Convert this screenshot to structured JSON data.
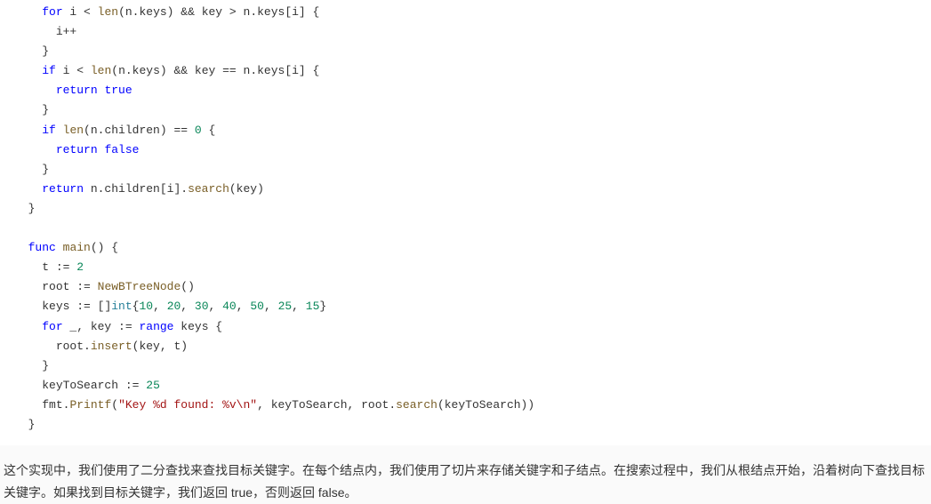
{
  "code": {
    "lines": [
      {
        "indent": 2,
        "tokens": [
          {
            "t": "keyword",
            "v": "for"
          },
          {
            "t": "normal",
            "v": " i "
          },
          {
            "t": "operator",
            "v": "<"
          },
          {
            "t": "normal",
            "v": " "
          },
          {
            "t": "func-name",
            "v": "len"
          },
          {
            "t": "normal",
            "v": "(n.keys) "
          },
          {
            "t": "operator",
            "v": "&&"
          },
          {
            "t": "normal",
            "v": " key "
          },
          {
            "t": "operator",
            "v": ">"
          },
          {
            "t": "normal",
            "v": " n.keys[i] {"
          }
        ]
      },
      {
        "indent": 3,
        "tokens": [
          {
            "t": "normal",
            "v": "i"
          },
          {
            "t": "operator",
            "v": "++"
          }
        ]
      },
      {
        "indent": 2,
        "tokens": [
          {
            "t": "normal",
            "v": "}"
          }
        ]
      },
      {
        "indent": 2,
        "tokens": [
          {
            "t": "keyword",
            "v": "if"
          },
          {
            "t": "normal",
            "v": " i "
          },
          {
            "t": "operator",
            "v": "<"
          },
          {
            "t": "normal",
            "v": " "
          },
          {
            "t": "func-name",
            "v": "len"
          },
          {
            "t": "normal",
            "v": "(n.keys) "
          },
          {
            "t": "operator",
            "v": "&&"
          },
          {
            "t": "normal",
            "v": " key "
          },
          {
            "t": "operator",
            "v": "=="
          },
          {
            "t": "normal",
            "v": " n.keys[i] {"
          }
        ]
      },
      {
        "indent": 3,
        "tokens": [
          {
            "t": "keyword",
            "v": "return"
          },
          {
            "t": "normal",
            "v": " "
          },
          {
            "t": "keyword",
            "v": "true"
          }
        ]
      },
      {
        "indent": 2,
        "tokens": [
          {
            "t": "normal",
            "v": "}"
          }
        ]
      },
      {
        "indent": 2,
        "tokens": [
          {
            "t": "keyword",
            "v": "if"
          },
          {
            "t": "normal",
            "v": " "
          },
          {
            "t": "func-name",
            "v": "len"
          },
          {
            "t": "normal",
            "v": "(n.children) "
          },
          {
            "t": "operator",
            "v": "=="
          },
          {
            "t": "normal",
            "v": " "
          },
          {
            "t": "number",
            "v": "0"
          },
          {
            "t": "normal",
            "v": " {"
          }
        ]
      },
      {
        "indent": 3,
        "tokens": [
          {
            "t": "keyword",
            "v": "return"
          },
          {
            "t": "normal",
            "v": " "
          },
          {
            "t": "keyword",
            "v": "false"
          }
        ]
      },
      {
        "indent": 2,
        "tokens": [
          {
            "t": "normal",
            "v": "}"
          }
        ]
      },
      {
        "indent": 2,
        "tokens": [
          {
            "t": "keyword",
            "v": "return"
          },
          {
            "t": "normal",
            "v": " n.children[i]."
          },
          {
            "t": "func-name",
            "v": "search"
          },
          {
            "t": "normal",
            "v": "(key)"
          }
        ]
      },
      {
        "indent": 1,
        "tokens": [
          {
            "t": "normal",
            "v": "}"
          }
        ]
      },
      {
        "indent": 0,
        "tokens": []
      },
      {
        "indent": 1,
        "tokens": [
          {
            "t": "keyword",
            "v": "func"
          },
          {
            "t": "normal",
            "v": " "
          },
          {
            "t": "func-name",
            "v": "main"
          },
          {
            "t": "normal",
            "v": "() {"
          }
        ]
      },
      {
        "indent": 2,
        "tokens": [
          {
            "t": "normal",
            "v": "t "
          },
          {
            "t": "operator",
            "v": ":="
          },
          {
            "t": "normal",
            "v": " "
          },
          {
            "t": "number",
            "v": "2"
          }
        ]
      },
      {
        "indent": 2,
        "tokens": [
          {
            "t": "normal",
            "v": "root "
          },
          {
            "t": "operator",
            "v": ":="
          },
          {
            "t": "normal",
            "v": " "
          },
          {
            "t": "func-name",
            "v": "NewBTreeNode"
          },
          {
            "t": "normal",
            "v": "()"
          }
        ]
      },
      {
        "indent": 2,
        "tokens": [
          {
            "t": "normal",
            "v": "keys "
          },
          {
            "t": "operator",
            "v": ":="
          },
          {
            "t": "normal",
            "v": " []"
          },
          {
            "t": "type",
            "v": "int"
          },
          {
            "t": "normal",
            "v": "{"
          },
          {
            "t": "number",
            "v": "10"
          },
          {
            "t": "normal",
            "v": ", "
          },
          {
            "t": "number",
            "v": "20"
          },
          {
            "t": "normal",
            "v": ", "
          },
          {
            "t": "number",
            "v": "30"
          },
          {
            "t": "normal",
            "v": ", "
          },
          {
            "t": "number",
            "v": "40"
          },
          {
            "t": "normal",
            "v": ", "
          },
          {
            "t": "number",
            "v": "50"
          },
          {
            "t": "normal",
            "v": ", "
          },
          {
            "t": "number",
            "v": "25"
          },
          {
            "t": "normal",
            "v": ", "
          },
          {
            "t": "number",
            "v": "15"
          },
          {
            "t": "normal",
            "v": "}"
          }
        ]
      },
      {
        "indent": 2,
        "tokens": [
          {
            "t": "keyword",
            "v": "for"
          },
          {
            "t": "normal",
            "v": " _, key "
          },
          {
            "t": "operator",
            "v": ":="
          },
          {
            "t": "normal",
            "v": " "
          },
          {
            "t": "keyword",
            "v": "range"
          },
          {
            "t": "normal",
            "v": " keys {"
          }
        ]
      },
      {
        "indent": 3,
        "tokens": [
          {
            "t": "normal",
            "v": "root."
          },
          {
            "t": "func-name",
            "v": "insert"
          },
          {
            "t": "normal",
            "v": "(key, t)"
          }
        ]
      },
      {
        "indent": 2,
        "tokens": [
          {
            "t": "normal",
            "v": "}"
          }
        ]
      },
      {
        "indent": 2,
        "tokens": [
          {
            "t": "normal",
            "v": "keyToSearch "
          },
          {
            "t": "operator",
            "v": ":="
          },
          {
            "t": "normal",
            "v": " "
          },
          {
            "t": "number",
            "v": "25"
          }
        ]
      },
      {
        "indent": 2,
        "tokens": [
          {
            "t": "normal",
            "v": "fmt."
          },
          {
            "t": "func-name",
            "v": "Printf"
          },
          {
            "t": "normal",
            "v": "("
          },
          {
            "t": "string",
            "v": "\"Key %d found: %v\\n\""
          },
          {
            "t": "normal",
            "v": ", keyToSearch, root."
          },
          {
            "t": "func-name",
            "v": "search"
          },
          {
            "t": "normal",
            "v": "(keyToSearch))"
          }
        ]
      },
      {
        "indent": 1,
        "tokens": [
          {
            "t": "normal",
            "v": "}"
          }
        ]
      }
    ]
  },
  "paragraph": "这个实现中，我们使用了二分查找来查找目标关键字。在每个结点内，我们使用了切片来存储关键字和子结点。在搜索过程中，我们从根结点开始，沿着树向下查找目标关键字。如果找到目标关键字，我们返回 true，否则返回 false。"
}
